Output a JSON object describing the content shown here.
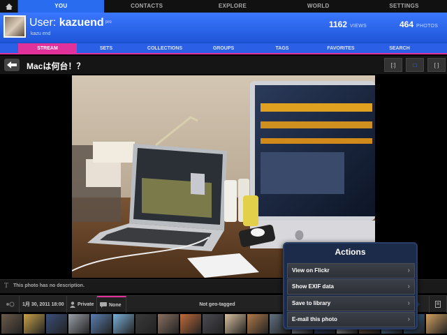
{
  "topnav": {
    "tabs": [
      {
        "label": "YOU",
        "active": true
      },
      {
        "label": "CONTACTS",
        "active": false
      },
      {
        "label": "EXPLORE",
        "active": false
      },
      {
        "label": "WORLD",
        "active": false
      },
      {
        "label": "SETTINGS",
        "active": false
      }
    ]
  },
  "user": {
    "prefix": "User:",
    "name": "kazuend",
    "badge": "pro",
    "real_name": "kazu end",
    "views_count": "1162",
    "views_label": "VIEWS",
    "photos_count": "464",
    "photos_label": "PHOTOS"
  },
  "subtabs": [
    {
      "label": "STREAM",
      "active": true
    },
    {
      "label": "SETS",
      "active": false
    },
    {
      "label": "COLLECTIONS",
      "active": false
    },
    {
      "label": "GROUPS",
      "active": false
    },
    {
      "label": "TAGS",
      "active": false
    },
    {
      "label": "FAVORITES",
      "active": false
    },
    {
      "label": "SEARCH",
      "active": false
    }
  ],
  "photo_view": {
    "title": "Macは何台！？",
    "view_buttons": [
      "[:]",
      "□",
      "[ ]"
    ]
  },
  "description": {
    "icon": "T",
    "text": "This photo has no description."
  },
  "info": {
    "date": "1月 30, 2011 18:00",
    "privacy": "Private",
    "comments": "None",
    "geo": "Not geo-tagged"
  },
  "actions": {
    "title": "Actions",
    "items": [
      "View on Flickr",
      "Show EXIF data",
      "Save to library",
      "E-mail this photo"
    ]
  },
  "colors": {
    "brand_blue": "#2a6cf0",
    "brand_pink": "#e0329a"
  },
  "filmstrip_colors": [
    "#6a5a4a",
    "#c8a24a",
    "#3b4f7a",
    "#9aa0a8",
    "#5a7fb0",
    "#7ab0d8",
    "#3a3a3a",
    "#8a7060",
    "#c06a3a",
    "#4a4a52",
    "#d8c0a0",
    "#b07a4a",
    "#607080",
    "#a0a8b0",
    "#2a4a7a",
    "#c8c8c8",
    "#7a5a3a",
    "#5a8ab0",
    "#3a6a9a",
    "#d0a060",
    "#2a2a2a"
  ]
}
